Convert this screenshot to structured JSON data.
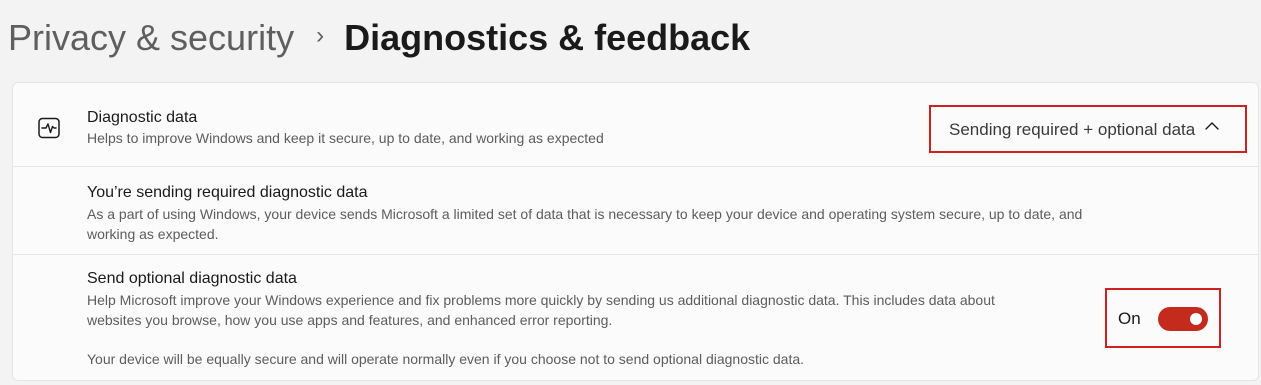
{
  "breadcrumb": {
    "parent": "Privacy & security",
    "separator": "›",
    "current": "Diagnostics & feedback"
  },
  "diagnostic_data": {
    "icon": "pulse-icon",
    "title": "Diagnostic data",
    "description": "Helps to improve Windows and keep it secure, up to date, and working as expected",
    "dropdown_value": "Sending required + optional data",
    "expanded": true
  },
  "required_section": {
    "title": "You’re sending required diagnostic data",
    "description_line1": "As a part of using Windows, your device sends Microsoft a limited set of data that is necessary to keep your device and operating system secure, up to date, and",
    "description_line2": "working as expected."
  },
  "optional_section": {
    "title": "Send optional diagnostic data",
    "description_line1": "Help Microsoft improve your Windows experience and fix problems more quickly by sending us additional diagnostic data. This includes data about",
    "description_line2": "websites you browse, how you use apps and features, and enhanced error reporting.",
    "note": "Your device will be equally secure and will operate normally even if you choose not to send optional diagnostic data.",
    "toggle_label": "On",
    "toggle_on": true
  },
  "colors": {
    "accent": "#c42b1c",
    "highlight_border": "#d02020"
  }
}
